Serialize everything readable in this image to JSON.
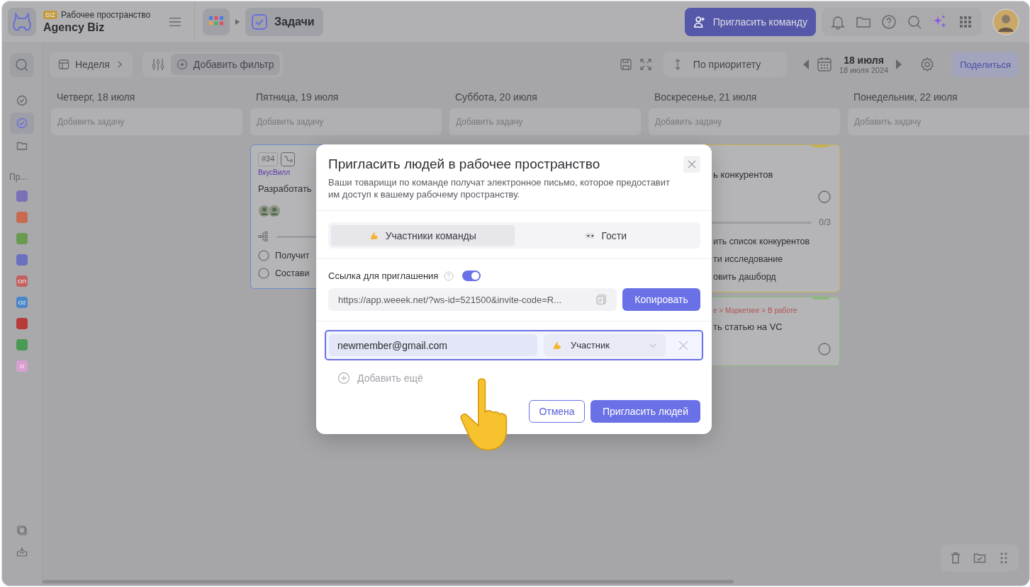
{
  "workspace": {
    "badge": "BIZ",
    "label": "Рабочее пространство",
    "name": "Agency Biz"
  },
  "breadcrumb": {
    "current": "Задачи"
  },
  "header": {
    "invite_button": "Пригласить команду"
  },
  "sidebar": {
    "nav": [
      {
        "kind": "check",
        "selected": false
      },
      {
        "kind": "check",
        "selected": true
      },
      {
        "kind": "folder",
        "selected": false
      }
    ],
    "section_label": "Пр...",
    "projects": [
      {
        "color": "#7a70b8"
      },
      {
        "color": "#c86a50"
      },
      {
        "color": "#6a9a50"
      },
      {
        "color": "#6a70c0"
      },
      {
        "color": "#c2615e",
        "label": "ОП"
      },
      {
        "color": "#4a86c8",
        "label": "О2"
      },
      {
        "color": "#b83a3a"
      },
      {
        "color": "#4a9a55"
      },
      {
        "color": "#d7a0cf",
        "label": "О"
      }
    ]
  },
  "toolbar": {
    "view": "Неделя",
    "filter": "Добавить фильтр",
    "sort": "По приоритету",
    "date": "18 июля",
    "date_full": "18 июля 2024",
    "share": "Поделиться"
  },
  "columns": [
    {
      "title": "Четверг, 18 июля",
      "placeholder": "Добавить задачу"
    },
    {
      "title": "Пятница, 19 июля",
      "placeholder": "Добавить задачу",
      "cards": [
        {
          "color": "#6a8fcc",
          "number": "#34",
          "project": "ВкусВилл",
          "title": "Разработать",
          "assigned": true,
          "progress": true,
          "subtasks": [
            {
              "text": "Получит",
              "done": false
            },
            {
              "text": "Состави",
              "done": false
            }
          ]
        }
      ]
    },
    {
      "title": "Суббота, 20 июля",
      "placeholder": "Добавить задачу"
    },
    {
      "title": "Воскресенье, 21 июля",
      "placeholder": "Добавить задачу",
      "cards": [
        {
          "color": "#c8b050",
          "title": "ь конкурентов",
          "done": false,
          "progress": true,
          "count": "0/3",
          "subtasks": [
            {
              "text": "ить список конкурентов"
            },
            {
              "text": "ти исследование"
            },
            {
              "text": "овить дашборд"
            }
          ]
        },
        {
          "color": "#8cb87a",
          "path": "е > Маркетинг > В работе",
          "title": "ть статью на VC",
          "done": false
        }
      ]
    },
    {
      "title": "Понедельник, 22 июля",
      "placeholder": "Добавить задачу"
    }
  ],
  "modal": {
    "title": "Пригласить людей в рабочее пространство",
    "description": "Ваши товарищи по команде получат электронное письмо, которое предоставит им доступ к вашему рабочему пространству.",
    "tabs": [
      {
        "kind": "members",
        "label": "Участники команды",
        "selected": true
      },
      {
        "kind": "guests",
        "label": "Гости",
        "selected": false
      }
    ],
    "link_label": "Ссылка для приглашения",
    "link_enabled": true,
    "link": "https://app.weeek.net/?ws-id=521500&invite-code=R...",
    "copy_button": "Копировать",
    "invites": [
      {
        "email": "newmember@gmail.com",
        "role": "Участник"
      }
    ],
    "add_more": "Добавить ещё",
    "cancel_button": "Отмена",
    "submit_button": "Пригласить людей"
  }
}
